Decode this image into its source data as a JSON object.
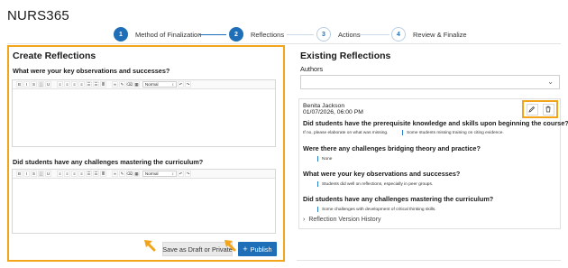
{
  "header": {
    "course": "NURS365"
  },
  "stepper": {
    "steps": [
      {
        "num": "1",
        "label": "Method of Finalization",
        "state": "active"
      },
      {
        "num": "2",
        "label": "Reflections",
        "state": "active"
      },
      {
        "num": "3",
        "label": "Actions",
        "state": "inactive"
      },
      {
        "num": "4",
        "label": "Review & Finalize",
        "state": "inactive"
      }
    ]
  },
  "create": {
    "title": "Create Reflections",
    "q1": "What were your key observations and successes?",
    "q2": "Did students have any challenges mastering the curriculum?",
    "toolbar": {
      "buttons": [
        "B",
        "I",
        "S",
        "[ ]",
        "U",
        "≡",
        "≡",
        "≡",
        "≡",
        "☰",
        "☰",
        "≣",
        "∞",
        "✎",
        "⌫",
        "▦"
      ],
      "format_value": "Normal",
      "undo": "↶",
      "redo": "↷"
    },
    "draft_label": "Save as Draft or Private",
    "publish_label": "Publish",
    "publish_icon": "+"
  },
  "existing": {
    "title": "Existing Reflections",
    "authors_label": "Authors",
    "authors_value": "",
    "card": {
      "author": "Benita Jackson",
      "date": "01/07/2026, 06:00 PM",
      "edit_icon": "pencil-icon",
      "delete_icon": "trash-icon",
      "q1": "Did students have the prerequisite knowledge and skills upon beginning the course?",
      "q1_prompt": "If no, please elaborate on what was missing.",
      "q1_answer": "Some students missing training on citing evidence.",
      "q2": "Were there any challenges bridging theory and practice?",
      "q2_answer": "None",
      "q3": "What were your key observations and successes?",
      "q3_answer": "Students did well on reflections, especially in peer groups.",
      "q4": "Did students have any challenges mastering the curriculum?",
      "q4_answer": "Some challenges with development of critical thinking skills.",
      "history": "Reflection Version History"
    }
  },
  "colors": {
    "accent": "#1f6fb8",
    "highlight": "#f2a51a"
  }
}
